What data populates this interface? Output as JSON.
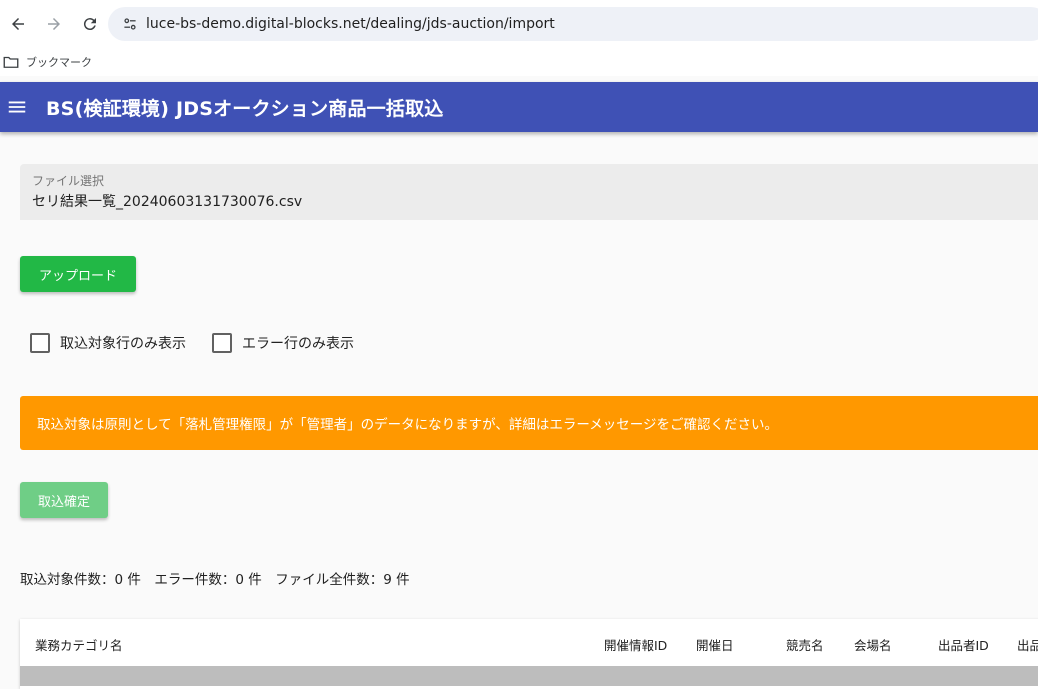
{
  "browser": {
    "url": "luce-bs-demo.digital-blocks.net/dealing/jds-auction/import",
    "bookmarks_label": "ブックマーク"
  },
  "app_bar": {
    "title": "BS(検証環境) JDSオークション商品一括取込"
  },
  "file_field": {
    "label": "ファイル選択",
    "value": "セリ結果一覧_20240603131730076.csv"
  },
  "upload_button": "アップロード",
  "filters": {
    "import_only": "取込対象行のみ表示",
    "error_only": "エラー行のみ表示"
  },
  "alert_message": "取込対象は原則として「落札管理権限」が「管理者」のデータになりますが、詳細はエラーメッセージをご確認ください。",
  "confirm_button": "取込確定",
  "counts_text": "取込対象件数：0 件　エラー件数：0 件　ファイル全件数：9 件",
  "table": {
    "columns": [
      "業務カテゴリ名",
      "開催情報ID",
      "開催日",
      "競売名",
      "会場名",
      "出品者ID",
      "出品"
    ]
  },
  "colors": {
    "app_bar": "#3f51b5",
    "upload_button": "#22b846",
    "confirm_button": "#6fce86",
    "alert": "#ff9800"
  }
}
